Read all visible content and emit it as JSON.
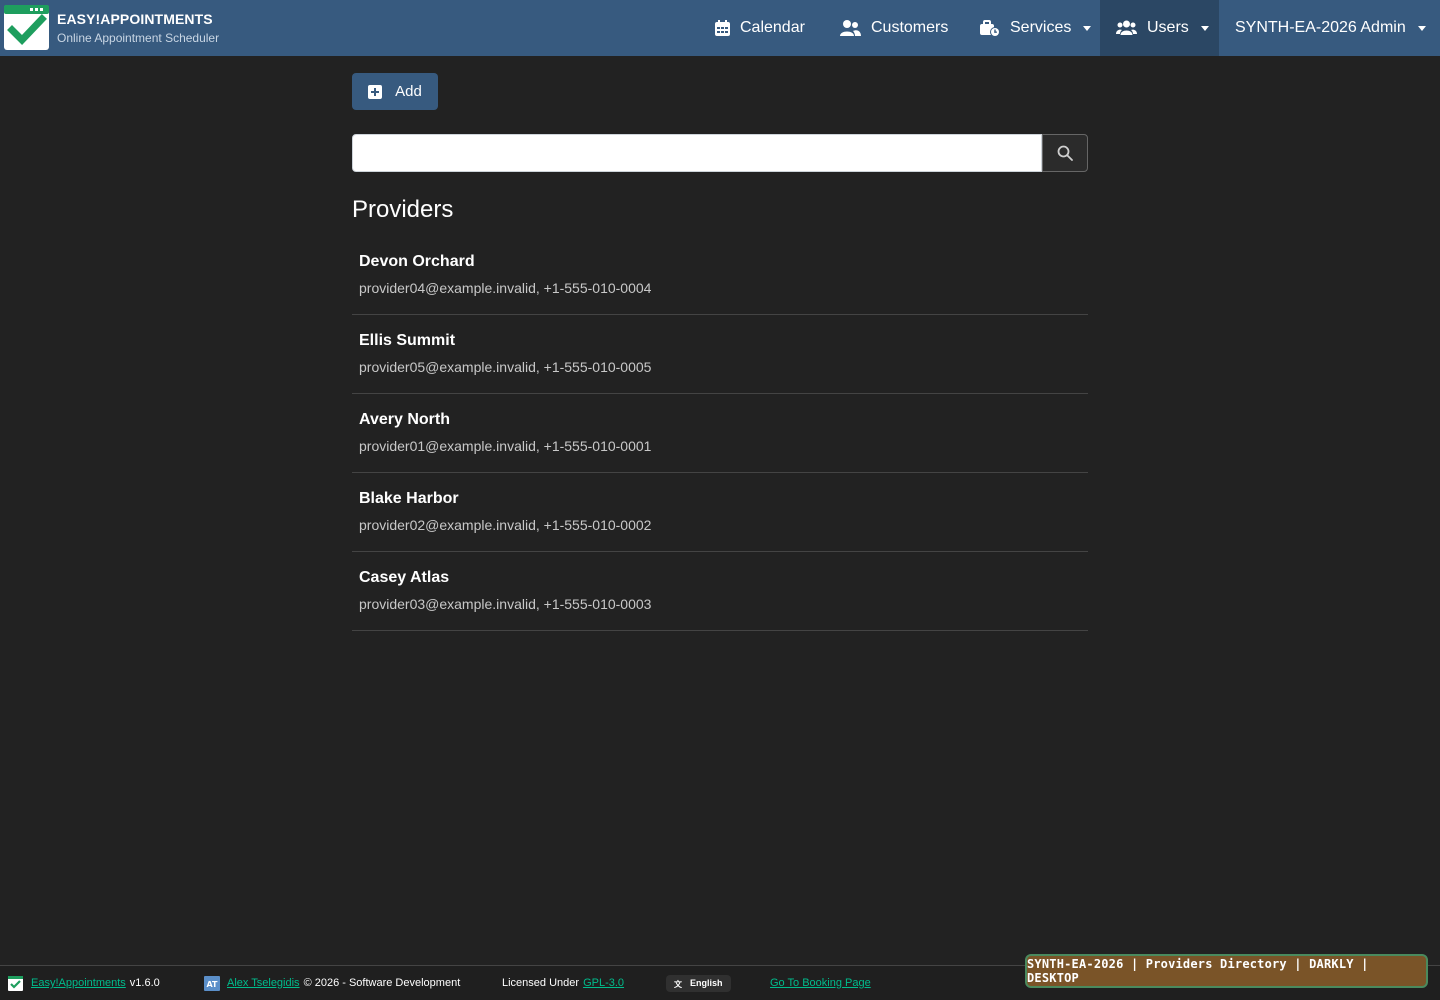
{
  "brand": {
    "title": "EASY!APPOINTMENTS",
    "subtitle": "Online Appointment Scheduler",
    "logo_icon": "check-calendar-icon",
    "accent_color": "#1e9e5e"
  },
  "nav": {
    "calendar": "Calendar",
    "customers": "Customers",
    "services": "Services",
    "users": "Users",
    "admin": "SYNTH-EA-2026 Admin",
    "bar_color": "#375a7f",
    "active_color": "#2b4764"
  },
  "toolbar": {
    "add_label": "Add",
    "search_placeholder": "",
    "search_value": ""
  },
  "section": {
    "title": "Providers"
  },
  "providers": [
    {
      "name": "Devon Orchard",
      "info": "provider04@example.invalid, +1-555-010-0004"
    },
    {
      "name": "Ellis Summit",
      "info": "provider05@example.invalid, +1-555-010-0005"
    },
    {
      "name": "Avery North",
      "info": "provider01@example.invalid, +1-555-010-0001"
    },
    {
      "name": "Blake Harbor",
      "info": "provider02@example.invalid, +1-555-010-0002"
    },
    {
      "name": "Casey Atlas",
      "info": "provider03@example.invalid, +1-555-010-0003"
    }
  ],
  "footer": {
    "app_link": "Easy!Appointments",
    "version": "v1.6.0",
    "author_link": "Alex Tselegidis",
    "copyright": "© 2026 - Software Development",
    "license_prefix": "Licensed Under",
    "license_link": "GPL-3.0",
    "language": "English",
    "booking_link": "Go To Booking Page",
    "link_color": "#00bc8c"
  },
  "badge": {
    "text": "SYNTH-EA-2026 | Providers Directory | DARKLY | DESKTOP"
  }
}
